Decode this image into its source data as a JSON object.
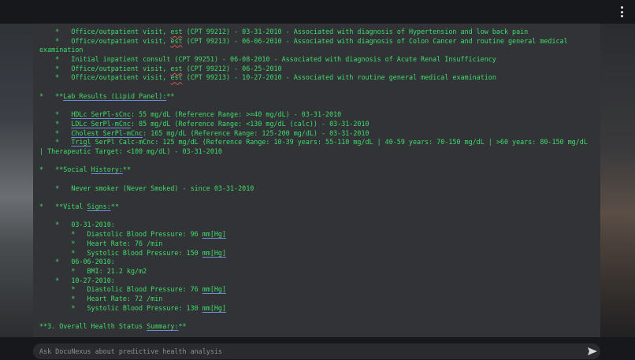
{
  "menu": {
    "icon": "kebab-menu-icon"
  },
  "visits": [
    {
      "pre": "    *   Office/outpatient visit, ",
      "mark": "est",
      "post": " (CPT 99212) - 03-31-2010 - Associated with diagnosis of Hypertension and low back pain"
    },
    {
      "pre": "    *   Office/outpatient visit, ",
      "mark": "est",
      "post": " (CPT 99213) - 06-06-2010 - Associated with diagnosis of Colon Cancer and routine general medical"
    },
    {
      "pre": "examination",
      "mark": "",
      "post": ""
    },
    {
      "pre": "    *   Initial inpatient consult (CPT 99251) - 06-08-2010 - Associated with diagnosis of Acute Renal Insufficiency",
      "mark": "",
      "post": ""
    },
    {
      "pre": "    *   Office/outpatient visit, ",
      "mark": "est",
      "post": " (CPT 99212) - 06-25-2010"
    },
    {
      "pre": "    *   Office/outpatient visit, ",
      "mark": "est",
      "post": " (CPT 99213) - 10-27-2010 - Associated with routine general medical examination"
    }
  ],
  "lab": {
    "heading_pre": "*   **",
    "heading": "Lab Results (Lipid Panel):",
    "heading_post": "**",
    "items": [
      {
        "pre": "    *   ",
        "mark": "HDLc SerPl-sCnc",
        "post": ": 55 mg/dL (Reference Range: >=40 mg/dL) - 03-31-2010"
      },
      {
        "pre": "    *   ",
        "mark": "LDLc SerPl-mCnc",
        "post": ": 85 mg/dL (Reference Range: <130 mg/dL (calc)) - 03-31-2010"
      },
      {
        "pre": "    *   ",
        "mark": "Cholest SerPl-mCnc",
        "post": ": 165 mg/dL (Reference Range: 125-200 mg/dL) - 03-31-2010"
      },
      {
        "pre": "    *   ",
        "mark": "Trigl",
        "post": " SerPl Calc-mCnc: 125 mg/dL (Reference Range: 10-39 years: 55-110 mg/dL | 40-59 years: 70-150 mg/dL | >60 years: 80-150 mg/dL"
      }
    ],
    "cont": "| Therapeutic Target: <100 mg/dL) - 03-31-2010"
  },
  "social": {
    "heading_pre": "*   **Social ",
    "heading": "History:",
    "heading_post": "**",
    "item": "    *   Never smoker (Never Smoked) - since 03-31-2010"
  },
  "vitals": {
    "heading_pre": "*   **Vital ",
    "heading": "Signs:",
    "heading_post": "**",
    "d1": "    *   03-31-2010:",
    "d1_items": [
      {
        "pre": "        *   Diastolic Blood Pressure: 96 ",
        "mark": "mm[Hg]"
      },
      {
        "pre": "        *   Heart Rate: 76 /min",
        "mark": ""
      },
      {
        "pre": "        *   Systolic Blood Pressure: 150 ",
        "mark": "mm[Hg]"
      }
    ],
    "d2": "    *   06-06-2010:",
    "d2_items": [
      {
        "pre": "        *   BMI: 21.2 kg/m2",
        "mark": ""
      }
    ],
    "d3": "    *   10-27-2010:",
    "d3_items": [
      {
        "pre": "        *   Diastolic Blood Pressure: 76 ",
        "mark": "mm[Hg]"
      },
      {
        "pre": "        *   Heart Rate: 72 /min",
        "mark": ""
      },
      {
        "pre": "        *   Systolic Blood Pressure: 130 ",
        "mark": "mm[Hg]"
      }
    ]
  },
  "summary": {
    "pre": "**3. Overall Health Status ",
    "mark": "Summary:",
    "post": "**"
  },
  "chat": {
    "placeholder": "Ask DocuNexus about predictive health analysis",
    "send_icon": "send-icon"
  }
}
